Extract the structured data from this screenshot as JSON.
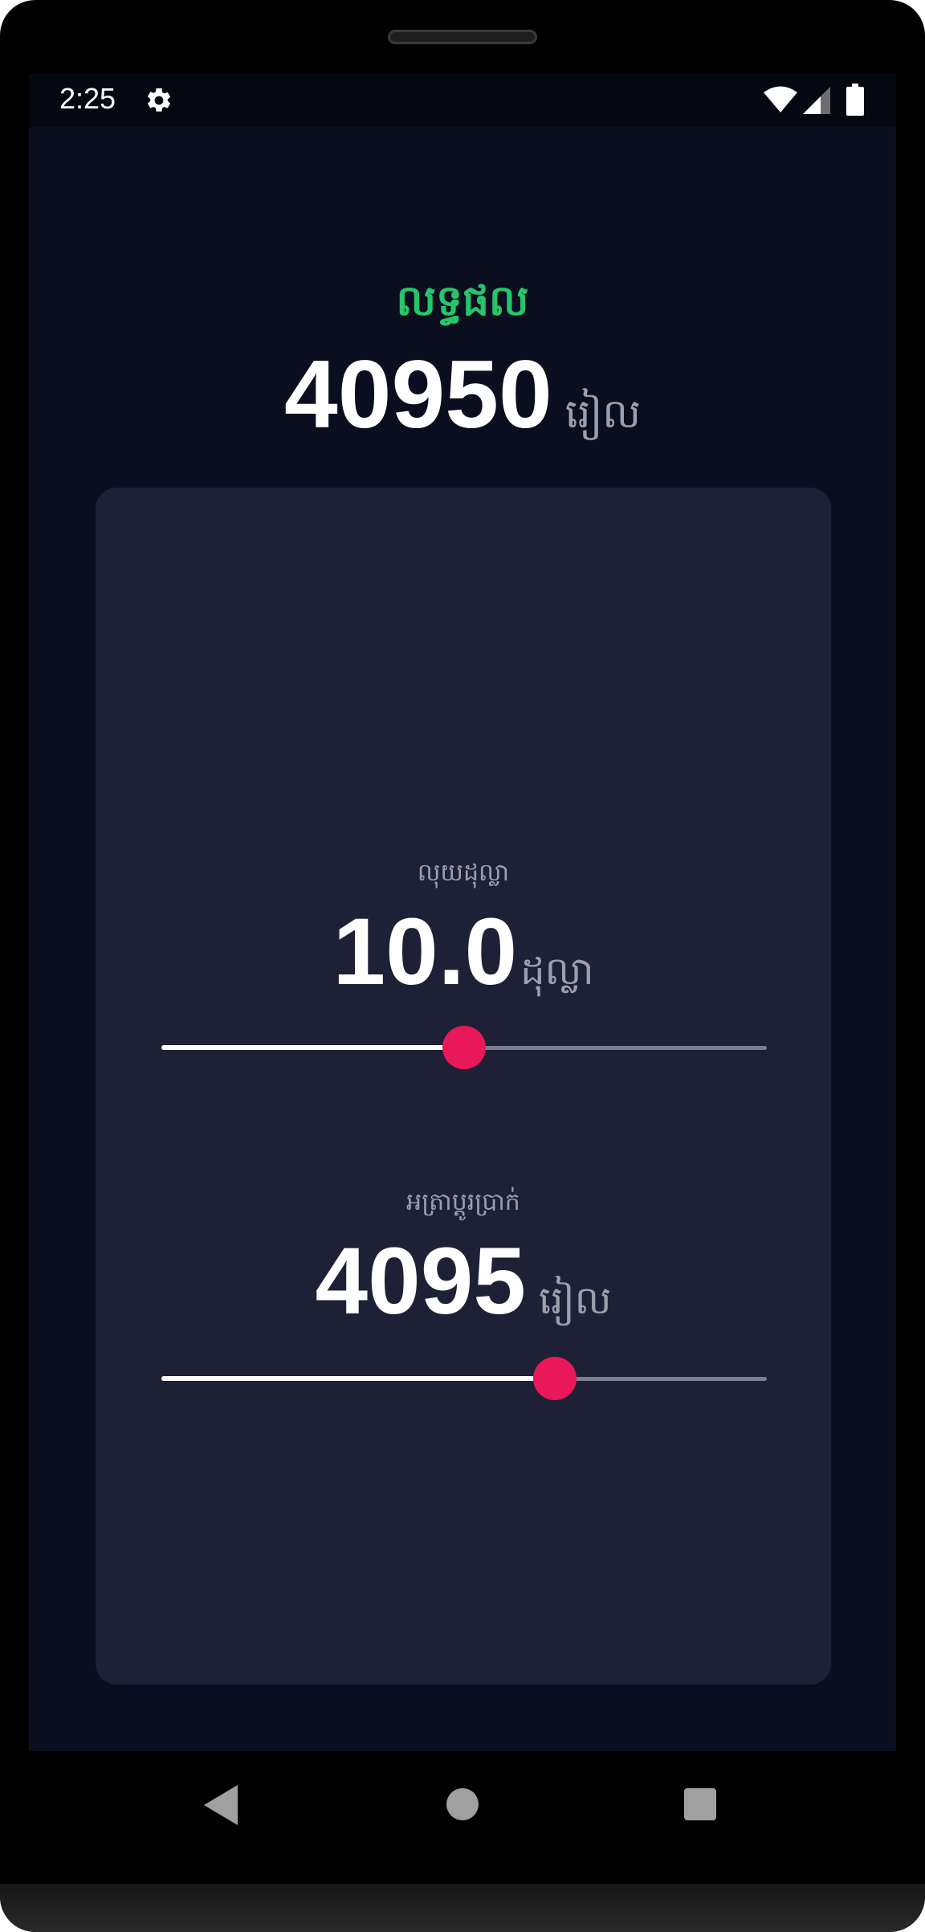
{
  "status_bar": {
    "time": "2:25",
    "icons": [
      "gear-icon",
      "wifi-icon",
      "signal-icon",
      "battery-icon"
    ]
  },
  "result": {
    "title": "លទ្ធផល",
    "value": "40950",
    "unit": "រៀល"
  },
  "dollar_input": {
    "label": "លុយដុល្លា",
    "value": "10.0",
    "unit": "ដុល្លា",
    "slider_fraction": 0.5
  },
  "exchange_rate": {
    "label": "អត្រាប្តូរប្រាក់",
    "value": "4095",
    "unit": "រៀល",
    "slider_fraction": 0.65
  },
  "colors": {
    "accent": "#e8185a",
    "result_title": "#27c46b",
    "background": "#0a0e1e",
    "card": "#1e2035"
  },
  "navigation": {
    "icons": [
      "back-icon",
      "home-icon",
      "recents-icon"
    ]
  }
}
